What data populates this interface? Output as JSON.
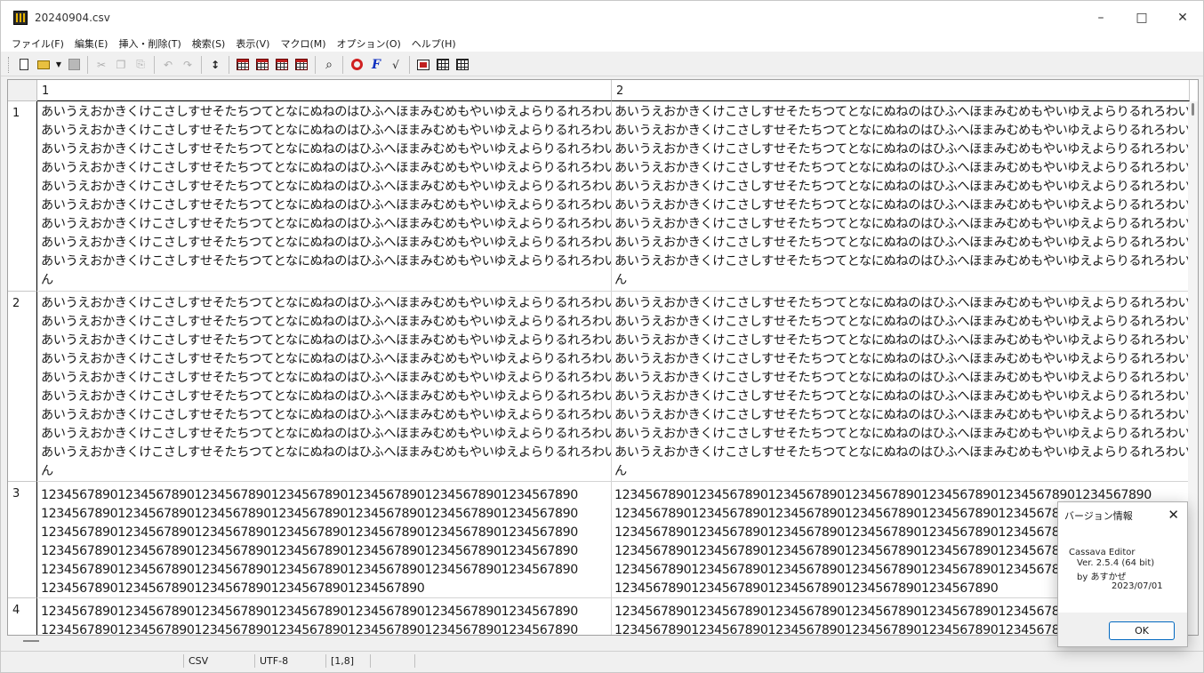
{
  "window": {
    "title": "20240904.csv"
  },
  "menu": [
    {
      "label": "ファイル(F)"
    },
    {
      "label": "編集(E)"
    },
    {
      "label": "挿入・削除(T)"
    },
    {
      "label": "検索(S)"
    },
    {
      "label": "表示(V)"
    },
    {
      "label": "マクロ(M)"
    },
    {
      "label": "オプション(O)"
    },
    {
      "label": "ヘルプ(H)"
    }
  ],
  "grid": {
    "columns": [
      "1",
      "2"
    ],
    "rows": [
      {
        "num": "1",
        "cells": [
          [
            "あいうえおかきくけこさしすせそたちつてとなにぬねのはひふへほまみむめもやいゆえよらりるれろわいうえを",
            "あいうえおかきくけこさしすせそたちつてとなにぬねのはひふへほまみむめもやいゆえよらりるれろわいうえを",
            "あいうえおかきくけこさしすせそたちつてとなにぬねのはひふへほまみむめもやいゆえよらりるれろわいうえを",
            "あいうえおかきくけこさしすせそたちつてとなにぬねのはひふへほまみむめもやいゆえよらりるれろわいうえを",
            "あいうえおかきくけこさしすせそたちつてとなにぬねのはひふへほまみむめもやいゆえよらりるれろわいうえを",
            "あいうえおかきくけこさしすせそたちつてとなにぬねのはひふへほまみむめもやいゆえよらりるれろわいうえを",
            "あいうえおかきくけこさしすせそたちつてとなにぬねのはひふへほまみむめもやいゆえよらりるれろわいうえを",
            "あいうえおかきくけこさしすせそたちつてとなにぬねのはひふへほまみむめもやいゆえよらりるれろわいうえを",
            "あいうえおかきくけこさしすせそたちつてとなにぬねのはひふへほまみむめもやいゆえよらりるれろわいうえを",
            "ん"
          ],
          [
            "あいうえおかきくけこさしすせそたちつてとなにぬねのはひふへほまみむめもやいゆえよらりるれろわいうえを",
            "あいうえおかきくけこさしすせそたちつてとなにぬねのはひふへほまみむめもやいゆえよらりるれろわいうえを",
            "あいうえおかきくけこさしすせそたちつてとなにぬねのはひふへほまみむめもやいゆえよらりるれろわいうえを",
            "あいうえおかきくけこさしすせそたちつてとなにぬねのはひふへほまみむめもやいゆえよらりるれろわいうえを",
            "あいうえおかきくけこさしすせそたちつてとなにぬねのはひふへほまみむめもやいゆえよらりるれろわいうえを",
            "あいうえおかきくけこさしすせそたちつてとなにぬねのはひふへほまみむめもやいゆえよらりるれろわいうえを",
            "あいうえおかきくけこさしすせそたちつてとなにぬねのはひふへほまみむめもやいゆえよらりるれろわいうえを",
            "あいうえおかきくけこさしすせそたちつてとなにぬねのはひふへほまみむめもやいゆえよらりるれろわいうえを",
            "あいうえおかきくけこさしすせそたちつてとなにぬねのはひふへほまみむめもやいゆえよらりるれろわいうえを",
            "ん"
          ]
        ]
      },
      {
        "num": "2",
        "cells": [
          [
            "あいうえおかきくけこさしすせそたちつてとなにぬねのはひふへほまみむめもやいゆえよらりるれろわいうえを",
            "あいうえおかきくけこさしすせそたちつてとなにぬねのはひふへほまみむめもやいゆえよらりるれろわいうえを",
            "あいうえおかきくけこさしすせそたちつてとなにぬねのはひふへほまみむめもやいゆえよらりるれろわいうえを",
            "あいうえおかきくけこさしすせそたちつてとなにぬねのはひふへほまみむめもやいゆえよらりるれろわいうえを",
            "あいうえおかきくけこさしすせそたちつてとなにぬねのはひふへほまみむめもやいゆえよらりるれろわいうえを",
            "あいうえおかきくけこさしすせそたちつてとなにぬねのはひふへほまみむめもやいゆえよらりるれろわいうえを",
            "あいうえおかきくけこさしすせそたちつてとなにぬねのはひふへほまみむめもやいゆえよらりるれろわいうえを",
            "あいうえおかきくけこさしすせそたちつてとなにぬねのはひふへほまみむめもやいゆえよらりるれろわいうえを",
            "あいうえおかきくけこさしすせそたちつてとなにぬねのはひふへほまみむめもやいゆえよらりるれろわいうえを",
            "ん"
          ],
          [
            "あいうえおかきくけこさしすせそたちつてとなにぬねのはひふへほまみむめもやいゆえよらりるれろわいうえを",
            "あいうえおかきくけこさしすせそたちつてとなにぬねのはひふへほまみむめもやいゆえよらりるれろわいうえを",
            "あいうえおかきくけこさしすせそたちつてとなにぬねのはひふへほまみむめもやいゆえよらりるれろわいうえを",
            "あいうえおかきくけこさしすせそたちつてとなにぬねのはひふへほまみむめもやいゆえよらりるれろわいうえを",
            "あいうえおかきくけこさしすせそたちつてとなにぬねのはひふへほまみむめもやいゆえよらりるれろわいうえを",
            "あいうえおかきくけこさしすせそたちつてとなにぬねのはひふへほまみむめもやいゆえよらりるれろわいうえを",
            "あいうえおかきくけこさしすせそたちつてとなにぬねのはひふへほまみむめもやいゆえよらりるれろわいうえを",
            "あいうえおかきくけこさしすせそたちつてとなにぬねのはひふへほまみむめもやいゆえよらりるれろわいうえを",
            "あいうえおかきくけこさしすせそたちつてとなにぬねのはひふへほまみむめもやいゆえよらりるれろわいうえを",
            "ん"
          ]
        ]
      },
      {
        "num": "3",
        "cells": [
          [
            "1234567890123456789012345678901234567890123456789012345678901234567890",
            "1234567890123456789012345678901234567890123456789012345678901234567890",
            "1234567890123456789012345678901234567890123456789012345678901234567890",
            "1234567890123456789012345678901234567890123456789012345678901234567890",
            "1234567890123456789012345678901234567890123456789012345678901234567890",
            "12345678901234567890123456789012345678901234567890"
          ],
          [
            "1234567890123456789012345678901234567890123456789012345678901234567890",
            "1234567890123456789012345678901234567890123456789012345678901234567890",
            "1234567890123456789012345678901234567890123456789012345678901234567890",
            "1234567890123456789012345678901234567890123456789012345678901234567890",
            "1234567890123456789012345678901234567890123456789012345678901234567890",
            "12345678901234567890123456789012345678901234567890"
          ]
        ]
      },
      {
        "num": "4",
        "cells": [
          [
            "1234567890123456789012345678901234567890123456789012345678901234567890",
            "1234567890123456789012345678901234567890123456789012345678901234567890"
          ],
          [
            "1234567890123456789012345678901234567890123456789012345678901234567890",
            "1234567890123456789012345678901234567890123456789012345678901234567890"
          ]
        ]
      }
    ]
  },
  "status": {
    "format": "CSV",
    "encoding": "UTF-8",
    "position": "[1,8]"
  },
  "dialog": {
    "title": "バージョン情報",
    "app_name": "Cassava Editor",
    "version": "Ver. 2.5.4 (64 bit)",
    "author": "by あすかぜ",
    "date": "2023/07/01",
    "ok_label": "OK"
  },
  "colors": {
    "accent": "#0067c0",
    "icon_red": "#c02020",
    "icon_blue": "#1030c0"
  }
}
